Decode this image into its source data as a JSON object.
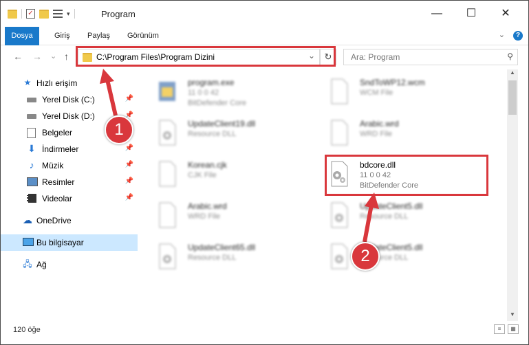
{
  "window": {
    "title": "Program",
    "minimize": "—",
    "maximize": "☐",
    "close": "✕"
  },
  "ribbon": {
    "tabs": [
      "Dosya",
      "Giriş",
      "Paylaş",
      "Görünüm"
    ],
    "expand_icon": "chevron-down-icon",
    "help": "?"
  },
  "nav": {
    "back": "←",
    "forward": "→",
    "dropdown": "⌄",
    "up": "↑",
    "address": "C:\\Program Files\\Program Dizini",
    "search_placeholder": "Ara: Program"
  },
  "sidebar": {
    "items": [
      {
        "label": "Hızlı erişim",
        "icon": "star-icon"
      },
      {
        "label": "Yerel Disk (C:)",
        "icon": "drive-icon",
        "pinned": true
      },
      {
        "label": "Yerel Disk (D:)",
        "icon": "drive-icon",
        "pinned": true
      },
      {
        "label": "Belgeler",
        "icon": "documents-icon",
        "pinned": true
      },
      {
        "label": "İndirmeler",
        "icon": "download-icon",
        "pinned": true
      },
      {
        "label": "Müzik",
        "icon": "music-icon",
        "pinned": true
      },
      {
        "label": "Resimler",
        "icon": "pictures-icon",
        "pinned": true
      },
      {
        "label": "Videolar",
        "icon": "videos-icon",
        "pinned": true
      },
      {
        "label": "OneDrive",
        "icon": "cloud-icon"
      },
      {
        "label": "Bu bilgisayar",
        "icon": "computer-icon",
        "selected": true
      },
      {
        "label": "Ağ",
        "icon": "network-icon"
      }
    ]
  },
  "files": [
    {
      "name": "program.exe",
      "line2": "11 0 0 42",
      "line3": "BitDefender Core",
      "icon": "exe-icon"
    },
    {
      "name": "SndToWP12.wcm",
      "line2": "WCM File",
      "line3": "",
      "icon": "file-icon"
    },
    {
      "name": "UpdateClient19.dll",
      "line2": "Resource DLL",
      "line3": "",
      "icon": "dll-icon"
    },
    {
      "name": "Arabic.wrd",
      "line2": "WRD File",
      "line3": "",
      "icon": "file-icon"
    },
    {
      "name": "Korean.cjk",
      "line2": "CJK File",
      "line3": "",
      "icon": "file-icon"
    },
    {
      "name": "bdcore.dll",
      "line2": "11 0 0 42",
      "line3": "BitDefender Core",
      "icon": "dll-icon",
      "highlighted": true
    },
    {
      "name": "Arabic.wrd",
      "line2": "WRD File",
      "line3": "",
      "icon": "file-icon"
    },
    {
      "name": "UpdateClient5.dll",
      "line2": "Resource DLL",
      "line3": "",
      "icon": "dll-icon"
    },
    {
      "name": "UpdateClient65.dll",
      "line2": "Resource DLL",
      "line3": "",
      "icon": "dll-icon"
    },
    {
      "name": "UpdateClient5.dll",
      "line2": "Resource DLL",
      "line3": "",
      "icon": "dll-icon"
    }
  ],
  "status": {
    "count": "120 öğe"
  },
  "annotations": {
    "step1": "1",
    "step2": "2",
    "color": "#d9373c"
  }
}
